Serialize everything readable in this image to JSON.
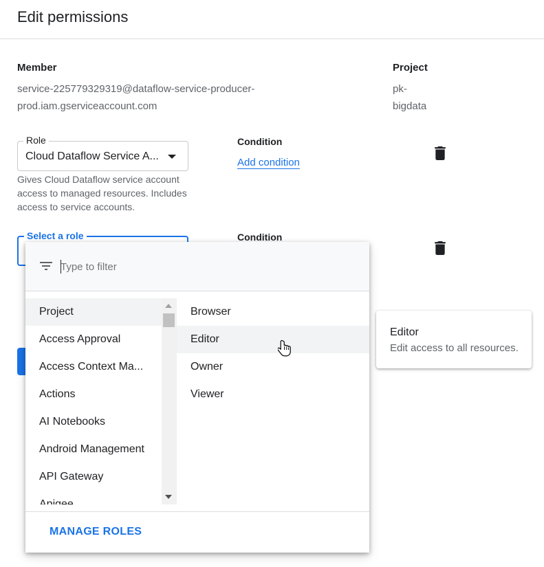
{
  "header": {
    "title": "Edit permissions"
  },
  "member": {
    "label": "Member",
    "line1": "service-225779329319@dataflow-service-producer-",
    "line2": "prod.iam.gserviceaccount.com"
  },
  "project": {
    "label": "Project",
    "line1": "pk-",
    "line2": "bigdata"
  },
  "role_row_1": {
    "legend": "Role",
    "value": "Cloud Dataflow Service A...",
    "helper": [
      "Gives Cloud Dataflow service account",
      "access to managed resources. Includes",
      "access to service accounts."
    ],
    "condition_label": "Condition",
    "condition_link": "Add condition",
    "trash_icon": "trash-icon"
  },
  "role_row_2": {
    "legend": "Select a role",
    "condition_label": "Condition",
    "trash_icon": "trash-icon"
  },
  "role_picker": {
    "filter_icon": "filter-icon",
    "filter_placeholder": "Type to filter",
    "services": [
      "Project",
      "Access Approval",
      "Access Context Ma...",
      "Actions",
      "AI Notebooks",
      "Android Management",
      "API Gateway",
      "Apigee"
    ],
    "selected_service": "Project",
    "roles": [
      "Browser",
      "Editor",
      "Owner",
      "Viewer"
    ],
    "hovered_role": "Editor",
    "footer_button": "MANAGE ROLES"
  },
  "role_tooltip": {
    "title": "Editor",
    "description": "Edit access to all resources."
  },
  "colors": {
    "accent": "#1a73e8",
    "text": "#202124",
    "muted": "#5f6368",
    "divider": "#dadce0"
  }
}
